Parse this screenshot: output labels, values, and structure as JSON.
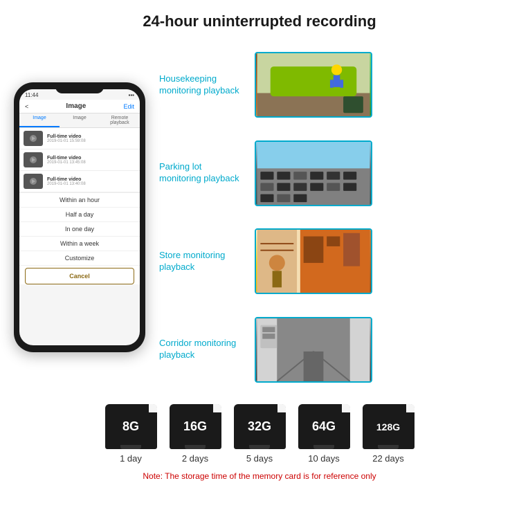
{
  "header": {
    "title": "24-hour uninterrupted recording"
  },
  "phone": {
    "time": "11:44",
    "nav_back": "<",
    "nav_title": "Image",
    "nav_edit": "Edit",
    "tab_image": "Image",
    "tab_image2": "Image",
    "tab_remote": "Remote playback",
    "videos": [
      {
        "title": "Full-time video",
        "date": "2019-01-01 15:59:08"
      },
      {
        "title": "Full-time video",
        "date": "2019-01-01 13:45:08"
      },
      {
        "title": "Full-time video",
        "date": "2019-01-01 13:40:08"
      }
    ],
    "dropdown": {
      "items": [
        "Within an hour",
        "Half a day",
        "In one day",
        "Within a week",
        "Customize"
      ],
      "cancel": "Cancel"
    }
  },
  "monitoring": [
    {
      "label": "Housekeeping\nmonitoring playback",
      "type": "housekeeping"
    },
    {
      "label": "Parking lot\nmonitoring playback",
      "type": "parking"
    },
    {
      "label": "Store monitoring\nplayback",
      "type": "store"
    },
    {
      "label": "Corridor monitoring\nplayback",
      "type": "corridor"
    }
  ],
  "storage": {
    "cards": [
      {
        "size": "8G",
        "days": "1 day"
      },
      {
        "size": "16G",
        "days": "2 days"
      },
      {
        "size": "32G",
        "days": "5 days"
      },
      {
        "size": "64G",
        "days": "10 days"
      },
      {
        "size": "128G",
        "days": "22 days"
      }
    ],
    "note": "Note: The storage time of the memory card is for reference only"
  }
}
